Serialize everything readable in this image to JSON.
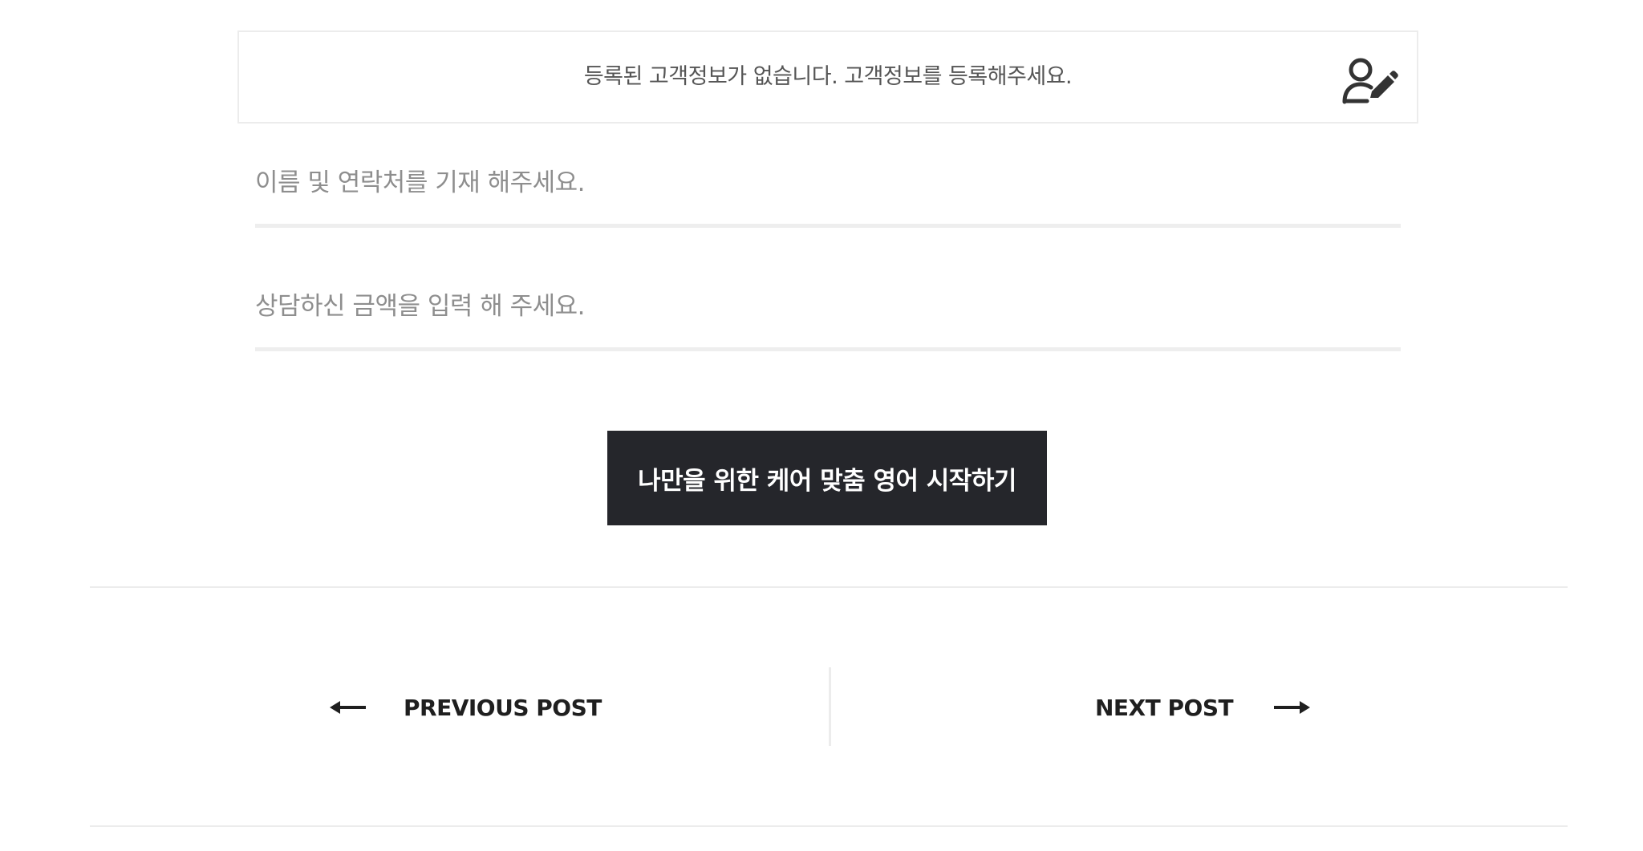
{
  "notice": {
    "text": "등록된 고객정보가 없습니다. 고객정보를 등록해주세요.",
    "icon": "user-edit-icon"
  },
  "form": {
    "name_contact_placeholder": "이름 및 연락처를 기재 해주세요.",
    "name_contact_value": "",
    "amount_placeholder": "상담하신 금액을 입력 해 주세요.",
    "amount_value": "",
    "submit_label": "나만을 위한 케어 맞춤 영어 시작하기"
  },
  "post_navigation": {
    "previous_label": "PREVIOUS POST",
    "previous_icon": "arrow-left-icon",
    "next_label": "NEXT POST",
    "next_icon": "arrow-right-icon"
  },
  "colors": {
    "button_bg": "#25262b",
    "button_text": "#ffffff",
    "divider": "#ececec",
    "placeholder": "#8e8e8e"
  }
}
